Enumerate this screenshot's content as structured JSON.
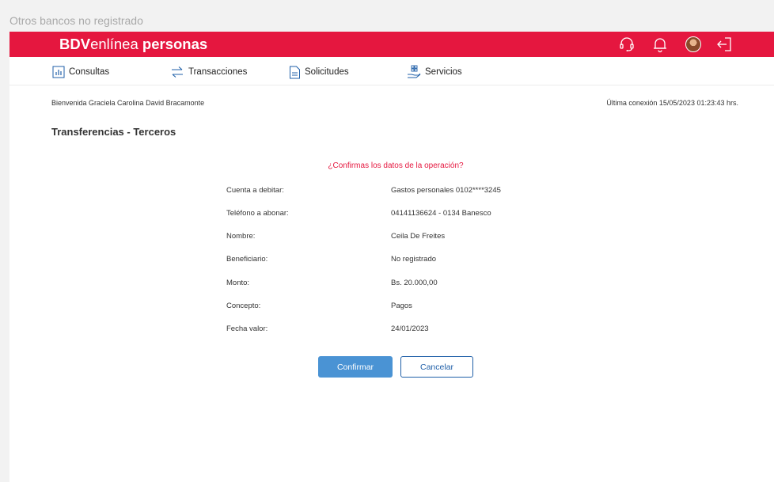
{
  "window": {
    "title": "Otros bancos no registrado"
  },
  "header": {
    "brand_bold": "BDV",
    "brand_light": "enlínea",
    "brand_bold2": "personas",
    "icons": [
      "support-headset-icon",
      "bell-icon",
      "avatar",
      "logout-icon"
    ],
    "color": "#e5173f"
  },
  "nav": {
    "items": [
      {
        "label": "Consultas",
        "icon": "bar-chart-icon"
      },
      {
        "label": "Transacciones",
        "icon": "transfer-arrows-icon"
      },
      {
        "label": "Solicitudes",
        "icon": "document-icon"
      },
      {
        "label": "Servicios",
        "icon": "services-hand-icon"
      }
    ]
  },
  "welcome": "Bienvenida Graciela Carolina David Bracamonte",
  "last_connection": "Última conexión 15/05/2023 01:23:43 hrs.",
  "page_title": "Transferencias - Terceros",
  "confirm_question": "¿Confirmas los datos de la operación?",
  "details": [
    {
      "label": "Cuenta a debitar:",
      "value": "Gastos personales 0102****3245"
    },
    {
      "label": "Teléfono a abonar:",
      "value": "04141136624 - 0134 Banesco"
    },
    {
      "label": "Nombre:",
      "value": "Ceila De Freites"
    },
    {
      "label": "Beneficiario:",
      "value": "No registrado"
    },
    {
      "label": "Monto:",
      "value": "Bs. 20.000,00"
    },
    {
      "label": "Concepto:",
      "value": "Pagos"
    },
    {
      "label": "Fecha valor:",
      "value": "24/01/2023"
    }
  ],
  "buttons": {
    "confirm": "Confirmar",
    "cancel": "Cancelar"
  }
}
